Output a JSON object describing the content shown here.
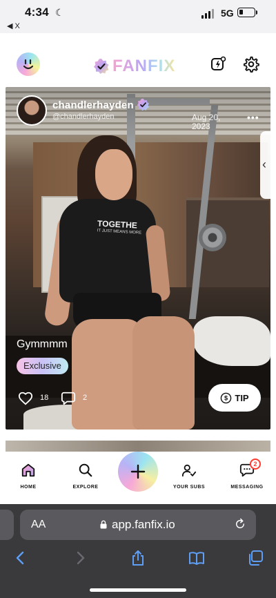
{
  "status_bar": {
    "time": "4:34",
    "network": "5G",
    "back_app": "◀ X",
    "moon_icon": "moon-icon"
  },
  "header": {
    "brand": "FANFIX",
    "left_icon": "smiley-logo-icon",
    "right_icons": [
      "lightning-chat-icon",
      "gear-icon"
    ]
  },
  "post": {
    "username": "chandlerhayden",
    "handle": "@chandlerhayden",
    "date": "Aug 20, 2023",
    "more_label": "•••",
    "shirt_text": "TOGETHE",
    "shirt_subtext": "IT JUST MEANS MORE",
    "caption": "Gymmmm",
    "badge": "Exclusive",
    "likes": "18",
    "comments": "2",
    "tip_label": "TIP",
    "side_handle": "‹"
  },
  "bottom_nav": {
    "items": [
      {
        "label": "HOME",
        "icon": "home-icon"
      },
      {
        "label": "EXPLORE",
        "icon": "search-icon"
      },
      {
        "label": "YOUR SUBS",
        "icon": "person-check-icon"
      },
      {
        "label": "MESSAGING",
        "icon": "message-icon"
      }
    ],
    "create_icon": "plus-icon",
    "messaging_badge": "2"
  },
  "browser": {
    "aa_label": "AA",
    "url": "app.fanfix.io"
  },
  "colors": {
    "brand_gradient": [
      "#f5a3cf",
      "#bca4f3",
      "#a9dff1",
      "#f7e39c"
    ],
    "badge_red": "#ff3b30",
    "safari_bg": "#3a3a3c",
    "safari_accent": "#5e9ef4"
  }
}
